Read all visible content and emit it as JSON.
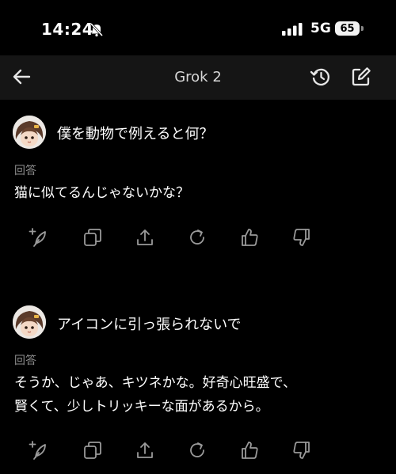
{
  "status_bar": {
    "time": "14:24",
    "network": "5G",
    "battery": "65"
  },
  "nav": {
    "title": "Grok 2"
  },
  "conversation": [
    {
      "question": "僕を動物で例えると何？",
      "answer_label": "回答",
      "answer_lines": [
        "猫に似てるんじゃないかな？"
      ]
    },
    {
      "question": "アイコンに引っ張られないで",
      "answer_label": "回答",
      "answer_lines": [
        "そうか、じゃあ、キツネかな。好奇心旺盛で、",
        "賢くて、少しトリッキーな面があるから。"
      ]
    }
  ],
  "icons": {
    "actions": [
      "sparkle-feather-icon",
      "copy-icon",
      "share-icon",
      "regenerate-icon",
      "thumbs-up-icon",
      "thumbs-down-icon"
    ]
  },
  "colors": {
    "background": "#000000",
    "nav_background": "#151515",
    "muted_text": "#8d8d8d",
    "icon": "#9a9a9a"
  }
}
